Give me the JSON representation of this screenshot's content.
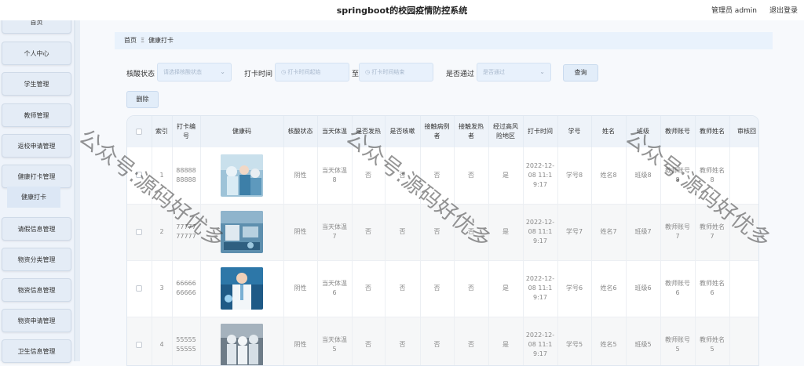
{
  "header": {
    "title": "springboot的校园疫情防控系统",
    "user_label": "管理员 admin",
    "logout_label": "退出登录"
  },
  "sidebar": {
    "items": [
      {
        "label": "首页"
      },
      {
        "label": "个人中心"
      },
      {
        "label": "学生管理"
      },
      {
        "label": "教师管理"
      },
      {
        "label": "返校申请管理"
      },
      {
        "label": "健康打卡管理"
      },
      {
        "label": "请假信息管理"
      },
      {
        "label": "物资分类管理"
      },
      {
        "label": "物资信息管理"
      },
      {
        "label": "物资申请管理"
      },
      {
        "label": "卫生信息管理"
      }
    ],
    "sub_item": "健康打卡"
  },
  "breadcrumb": {
    "home": "首页",
    "separator": "Ξ",
    "current": "健康打卡"
  },
  "search": {
    "nucleic_label": "核酸状态",
    "nucleic_placeholder": "请选择核酸状态",
    "time_label": "打卡时间",
    "time_start_placeholder": "打卡时间起始",
    "time_to": "至",
    "time_end_placeholder": "打卡时间结束",
    "pass_label": "是否通过",
    "pass_placeholder": "是否通过",
    "query_button": "查询"
  },
  "actions": {
    "delete_button": "删除"
  },
  "table": {
    "columns": [
      "",
      "索引",
      "打卡编号",
      "健康码",
      "核酸状态",
      "当天体温",
      "是否发热",
      "是否咳嗽",
      "接触病例者",
      "接触发热者",
      "经过高风险地区",
      "打卡时间",
      "学号",
      "姓名",
      "班级",
      "教师账号",
      "教师姓名",
      "审核回"
    ],
    "rows": [
      {
        "index": "1",
        "code": "8888888888",
        "nucleic": "阴性",
        "temp": "当天体温8",
        "fever": "否",
        "cough": "否",
        "contact_case": "否",
        "contact_fever": "否",
        "high_risk": "是",
        "time": "2022-12-08 11:19:17",
        "student_no": "学号8",
        "name": "姓名8",
        "class": "班级8",
        "teacher_no": "教师账号8",
        "teacher_name": "教师姓名8",
        "img": "lab"
      },
      {
        "index": "2",
        "code": "7777777777",
        "nucleic": "阴性",
        "temp": "当天体温7",
        "fever": "否",
        "cough": "否",
        "contact_case": "否",
        "contact_fever": "否",
        "high_risk": "是",
        "time": "2022-12-08 11:19:17",
        "student_no": "学号7",
        "name": "姓名7",
        "class": "班级7",
        "teacher_no": "教师账号7",
        "teacher_name": "教师姓名7",
        "img": "robot"
      },
      {
        "index": "3",
        "code": "6666666666",
        "nucleic": "阴性",
        "temp": "当天体温6",
        "fever": "否",
        "cough": "否",
        "contact_case": "否",
        "contact_fever": "否",
        "high_risk": "是",
        "time": "2022-12-08 11:19:17",
        "student_no": "学号6",
        "name": "姓名6",
        "class": "班级6",
        "teacher_no": "教师账号6",
        "teacher_name": "教师姓名6",
        "img": "doctor"
      },
      {
        "index": "4",
        "code": "5555555555",
        "nucleic": "阴性",
        "temp": "当天体温5",
        "fever": "否",
        "cough": "否",
        "contact_case": "否",
        "contact_fever": "否",
        "high_risk": "是",
        "time": "2022-12-08 11:19:17",
        "student_no": "学号5",
        "name": "姓名5",
        "class": "班级5",
        "teacher_no": "教师账号5",
        "teacher_name": "教师姓名5",
        "img": "suits"
      }
    ]
  },
  "watermark": "公众号:源码好优多",
  "colors": {
    "sidebar_bg": "#eef3fa",
    "menu_bg": "#e4ecf6",
    "field_bg": "#e8f1fc",
    "header_row_bg": "#eef3f9"
  }
}
